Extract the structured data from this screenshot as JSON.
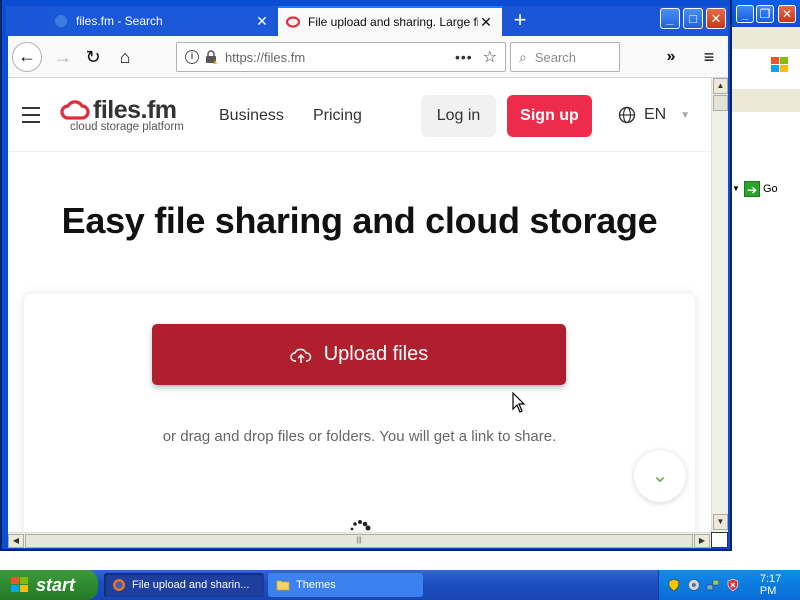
{
  "browser": {
    "tabs": [
      {
        "title": "files.fm - Search",
        "active": false
      },
      {
        "title": "File upload and sharing. Large file",
        "active": true
      }
    ],
    "url": "https://files.fm",
    "search_placeholder": "Search",
    "url_dots": "•••"
  },
  "site": {
    "logo_text": "files.fm",
    "logo_tagline": "cloud storage platform",
    "nav": [
      {
        "label": "Business"
      },
      {
        "label": "Pricing"
      }
    ],
    "login_label": "Log in",
    "signup_label": "Sign up",
    "language": "EN",
    "hero_title": "Easy file sharing and cloud storage",
    "upload_button_label": "Upload files",
    "drag_drop_text": "or drag and drop files or folders. You will get a link to share."
  },
  "background_window": {
    "go_label": "Go"
  },
  "taskbar": {
    "start_label": "start",
    "tasks": [
      {
        "label": "File upload and sharin...",
        "active": true
      },
      {
        "label": "Themes",
        "active": false
      }
    ],
    "clock": "7:17 PM"
  },
  "colors": {
    "brand_red": "#ee2b4b",
    "upload_red": "#b01f2e",
    "xp_blue": "#0b4ed4",
    "start_green": "#2e8a2e"
  }
}
